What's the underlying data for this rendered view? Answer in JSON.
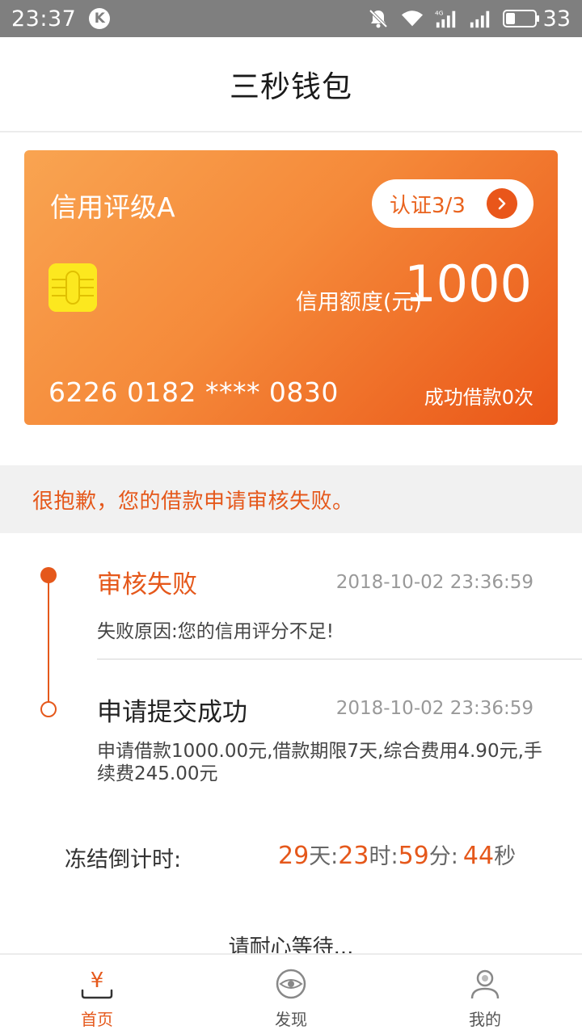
{
  "status_bar": {
    "time": "23:37",
    "badge_letter": "K",
    "battery_level": "33",
    "icons": [
      "notifications-muted-icon",
      "wifi-icon",
      "cellular-4g-icon",
      "cellular-signal-icon",
      "battery-icon"
    ]
  },
  "header": {
    "title": "三秒钱包"
  },
  "card": {
    "rating": "信用评级A",
    "cert_label": "认证3/3",
    "limit_label": "信用额度(元)",
    "limit_value": "1000",
    "card_number": "6226 0182 **** 0830",
    "borrow_count": "成功借款0次"
  },
  "notice": {
    "text": "很抱歉，您的借款申请审核失败。"
  },
  "timeline": {
    "items": [
      {
        "title": "审核失败",
        "time": "2018-10-02 23:36:59",
        "desc": "失败原因:您的信用评分不足!"
      },
      {
        "title": "申请提交成功",
        "time": "2018-10-02 23:36:59",
        "desc": "申请借款1000.00元,借款期限7天,综合费用4.90元,手续费245.00元"
      }
    ]
  },
  "countdown": {
    "label": "冻结倒计时:",
    "days": "29",
    "days_unit": "天:",
    "hours": "23",
    "hours_unit": "时:",
    "minutes": "59",
    "minutes_unit": "分:",
    "seconds": "44",
    "seconds_unit": "秒"
  },
  "waiting_text": "请耐心等待...",
  "tabbar": {
    "tabs": [
      {
        "label": "首页",
        "icon": "home-yen-icon",
        "active": true
      },
      {
        "label": "发现",
        "icon": "discover-eye-icon",
        "active": false
      },
      {
        "label": "我的",
        "icon": "profile-user-icon",
        "active": false
      }
    ]
  },
  "colors": {
    "accent": "#e5581b",
    "card_gradient_start": "#f9a451",
    "card_gradient_end": "#ea5618",
    "chip": "#fce81f",
    "status_bar": "#7f7f7f"
  }
}
